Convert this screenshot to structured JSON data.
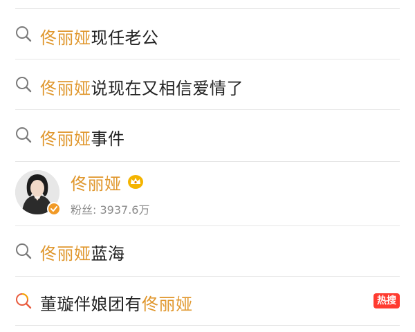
{
  "colors": {
    "highlight": "#e0972d",
    "text": "#222222",
    "divider": "#e6e6e6",
    "hot_badge": "#ff3b30",
    "muted": "#8a8a8a"
  },
  "suggestions": [
    {
      "highlight": "佟丽娅",
      "rest": "现任老公",
      "icon": "search-icon"
    },
    {
      "highlight": "佟丽娅",
      "rest": "说现在又相信爱情了",
      "icon": "search-icon"
    },
    {
      "highlight": "佟丽娅",
      "rest": "事件",
      "icon": "search-icon"
    },
    {
      "highlight": "佟丽娅",
      "rest": "蓝海",
      "icon": "search-icon"
    }
  ],
  "user": {
    "name": "佟丽娅",
    "fans_label": "粉丝: 3937.6万",
    "crown_icon": "crown-icon",
    "verified_icon": "verified-badge-icon"
  },
  "hot_item": {
    "prefix": "董璇伴娘团有",
    "highlight": "佟丽娅",
    "badge": "热搜",
    "icon": "hot-search-icon"
  }
}
